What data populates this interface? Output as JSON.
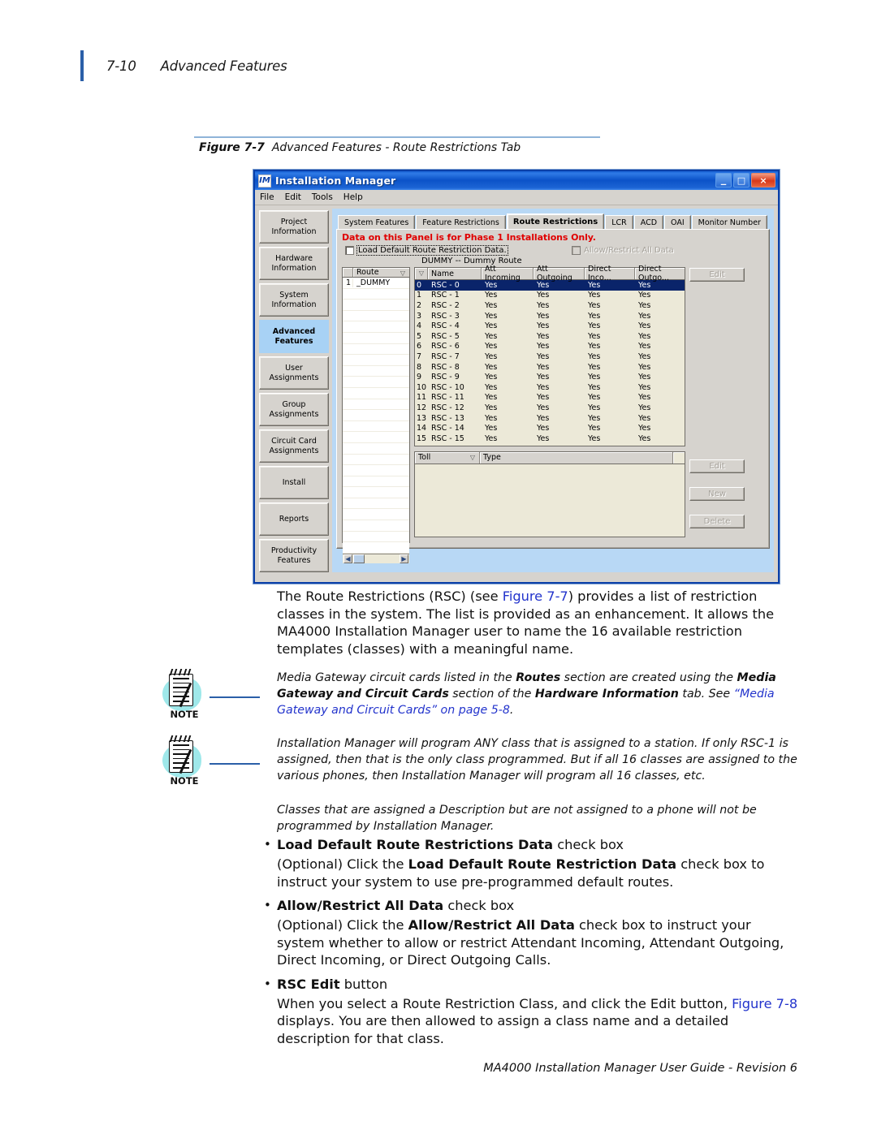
{
  "page_header": {
    "folio": "7-10",
    "chapter_title": "Advanced Features"
  },
  "figure": {
    "caption_number": "Figure 7-7",
    "caption_text": "Advanced Features - Route Restrictions Tab"
  },
  "app": {
    "icon": "im-logo-icon",
    "title": "Installation Manager",
    "window_buttons": {
      "minimize": "_",
      "maximize": "□",
      "close": "×"
    },
    "menu": [
      "File",
      "Edit",
      "Tools",
      "Help"
    ],
    "nav_items": [
      {
        "line1": "Project",
        "line2": "Information",
        "active": false
      },
      {
        "line1": "Hardware",
        "line2": "Information",
        "active": false
      },
      {
        "line1": "System",
        "line2": "Information",
        "active": false
      },
      {
        "line1": "Advanced",
        "line2": "Features",
        "active": true
      },
      {
        "line1": "User",
        "line2": "Assignments",
        "active": false
      },
      {
        "line1": "Group",
        "line2": "Assignments",
        "active": false
      },
      {
        "line1": "Circuit Card",
        "line2": "Assignments",
        "active": false
      },
      {
        "line1": "Install",
        "line2": "",
        "active": false
      },
      {
        "line1": "Reports",
        "line2": "",
        "active": false
      },
      {
        "line1": "Productivity",
        "line2": "Features",
        "active": false
      }
    ],
    "tabs": [
      {
        "label": "System Features",
        "active": false
      },
      {
        "label": "Feature Restrictions",
        "active": false
      },
      {
        "label": "Route Restrictions",
        "active": true
      },
      {
        "label": "LCR",
        "active": false
      },
      {
        "label": "ACD",
        "active": false
      },
      {
        "label": "OAI",
        "active": false
      },
      {
        "label": "Monitor Number",
        "active": false
      }
    ],
    "warning": "Data on this Panel is for Phase 1 Installations Only.",
    "checkboxes": [
      {
        "label": "Load Default Route Restriction Data.",
        "checked": false,
        "disabled": false
      },
      {
        "label": "Allow/Restrict All Data",
        "checked": false,
        "disabled": true
      }
    ],
    "route_heading": "DUMMY -- Dummy Route",
    "routes_grid": {
      "columns": [
        "",
        "Route"
      ],
      "sort_column": "Route",
      "rows": [
        {
          "num": "1",
          "route": "_DUMMY"
        }
      ]
    },
    "rsc_grid": {
      "columns": [
        "",
        "Name",
        "Att Incoming",
        "Att Outgoing",
        "Direct Inco...",
        "Direct Outgo..."
      ],
      "rows": [
        {
          "idx": "0",
          "name": "RSC - 0",
          "att_in": "Yes",
          "att_out": "Yes",
          "dir_in": "Yes",
          "dir_out": "Yes",
          "selected": true
        },
        {
          "idx": "1",
          "name": "RSC - 1",
          "att_in": "Yes",
          "att_out": "Yes",
          "dir_in": "Yes",
          "dir_out": "Yes",
          "selected": false
        },
        {
          "idx": "2",
          "name": "RSC - 2",
          "att_in": "Yes",
          "att_out": "Yes",
          "dir_in": "Yes",
          "dir_out": "Yes",
          "selected": false
        },
        {
          "idx": "3",
          "name": "RSC - 3",
          "att_in": "Yes",
          "att_out": "Yes",
          "dir_in": "Yes",
          "dir_out": "Yes",
          "selected": false
        },
        {
          "idx": "4",
          "name": "RSC - 4",
          "att_in": "Yes",
          "att_out": "Yes",
          "dir_in": "Yes",
          "dir_out": "Yes",
          "selected": false
        },
        {
          "idx": "5",
          "name": "RSC - 5",
          "att_in": "Yes",
          "att_out": "Yes",
          "dir_in": "Yes",
          "dir_out": "Yes",
          "selected": false
        },
        {
          "idx": "6",
          "name": "RSC - 6",
          "att_in": "Yes",
          "att_out": "Yes",
          "dir_in": "Yes",
          "dir_out": "Yes",
          "selected": false
        },
        {
          "idx": "7",
          "name": "RSC - 7",
          "att_in": "Yes",
          "att_out": "Yes",
          "dir_in": "Yes",
          "dir_out": "Yes",
          "selected": false
        },
        {
          "idx": "8",
          "name": "RSC - 8",
          "att_in": "Yes",
          "att_out": "Yes",
          "dir_in": "Yes",
          "dir_out": "Yes",
          "selected": false
        },
        {
          "idx": "9",
          "name": "RSC - 9",
          "att_in": "Yes",
          "att_out": "Yes",
          "dir_in": "Yes",
          "dir_out": "Yes",
          "selected": false
        },
        {
          "idx": "10",
          "name": "RSC - 10",
          "att_in": "Yes",
          "att_out": "Yes",
          "dir_in": "Yes",
          "dir_out": "Yes",
          "selected": false
        },
        {
          "idx": "11",
          "name": "RSC - 11",
          "att_in": "Yes",
          "att_out": "Yes",
          "dir_in": "Yes",
          "dir_out": "Yes",
          "selected": false
        },
        {
          "idx": "12",
          "name": "RSC - 12",
          "att_in": "Yes",
          "att_out": "Yes",
          "dir_in": "Yes",
          "dir_out": "Yes",
          "selected": false
        },
        {
          "idx": "13",
          "name": "RSC - 13",
          "att_in": "Yes",
          "att_out": "Yes",
          "dir_in": "Yes",
          "dir_out": "Yes",
          "selected": false
        },
        {
          "idx": "14",
          "name": "RSC - 14",
          "att_in": "Yes",
          "att_out": "Yes",
          "dir_in": "Yes",
          "dir_out": "Yes",
          "selected": false
        },
        {
          "idx": "15",
          "name": "RSC - 15",
          "att_in": "Yes",
          "att_out": "Yes",
          "dir_in": "Yes",
          "dir_out": "Yes",
          "selected": false
        }
      ]
    },
    "toll_grid": {
      "columns": [
        "Toll",
        "Type",
        ""
      ],
      "sort_column": "Toll",
      "rows": []
    },
    "buttons": {
      "edit_rsc": "Edit",
      "edit_toll": "Edit",
      "new_toll": "New",
      "delete_toll": "Delete"
    },
    "statusbar": ""
  },
  "body": {
    "para1_part1": "The Route Restrictions (RSC) (see ",
    "para1_link": "Figure 7-7",
    "para1_part2": ") provides a list of restriction classes in the system. The list is provided as an enhancement. It allows the MA4000 Installation Manager user to name the 16 available restriction templates (classes) with a meaningful name."
  },
  "notes": [
    {
      "label": "NOTE",
      "icon": "note-pad-pen-icon",
      "text_part1": "Media Gateway circuit cards listed in the ",
      "bold1": "Routes",
      "text_part2": " section are created using the ",
      "bold2": "Media Gateway and Circuit Cards",
      "text_part3": " section of the ",
      "bold3": "Hardware Information",
      "text_part4": " tab. See ",
      "link": "“Media Gateway and Circuit Cards” on page 5-8",
      "text_part5": "."
    },
    {
      "label": "NOTE",
      "icon": "note-pad-pen-icon",
      "text": "Installation Manager will program ANY class that is assigned to a station. If only RSC-1 is assigned, then that is the only class programmed. But if all 16 classes are assigned to the various phones, then Installation Manager will program all 16 classes, etc.",
      "text_extra": "Classes that are assigned a Description but are not assigned to a phone will not be programmed by Installation Manager."
    }
  ],
  "bullets": [
    {
      "bold_head": "Load Default Route Restrictions Data",
      "head_tail": " check box",
      "body_part1": "(Optional) Click the ",
      "body_bold": "Load Default Route Restriction Data",
      "body_part2": " check box to instruct your system to use pre-programmed default routes."
    },
    {
      "bold_head": "Allow/Restrict All Data",
      "head_tail": " check box",
      "body_part1": "(Optional) Click the ",
      "body_bold": "Allow/Restrict All Data",
      "body_part2": " check box to instruct your system whether to allow or restrict Attendant Incoming, Attendant Outgoing, Direct Incoming, or Direct Outgoing Calls."
    },
    {
      "bold_head": "RSC Edit",
      "head_tail": " button",
      "body_part1": "When you select a Route Restriction Class, and click the Edit button, ",
      "body_link": "Figure 7-8",
      "body_part2": " displays. You are then allowed to assign a class name and a detailed description for that class."
    }
  ],
  "footer": {
    "text": "MA4000 Installation Manager User Guide - Revision 6"
  },
  "colors": {
    "accent_blue": "#2b5fa8",
    "link_blue": "#2233cc",
    "warning_red": "#e00000",
    "selection_blue": "#0a246a",
    "panel_blue": "#b8d8f5",
    "nav_active": "#a8d2f5",
    "chrome_gray": "#d6d3ce",
    "grid_bg": "#ece9d8"
  }
}
